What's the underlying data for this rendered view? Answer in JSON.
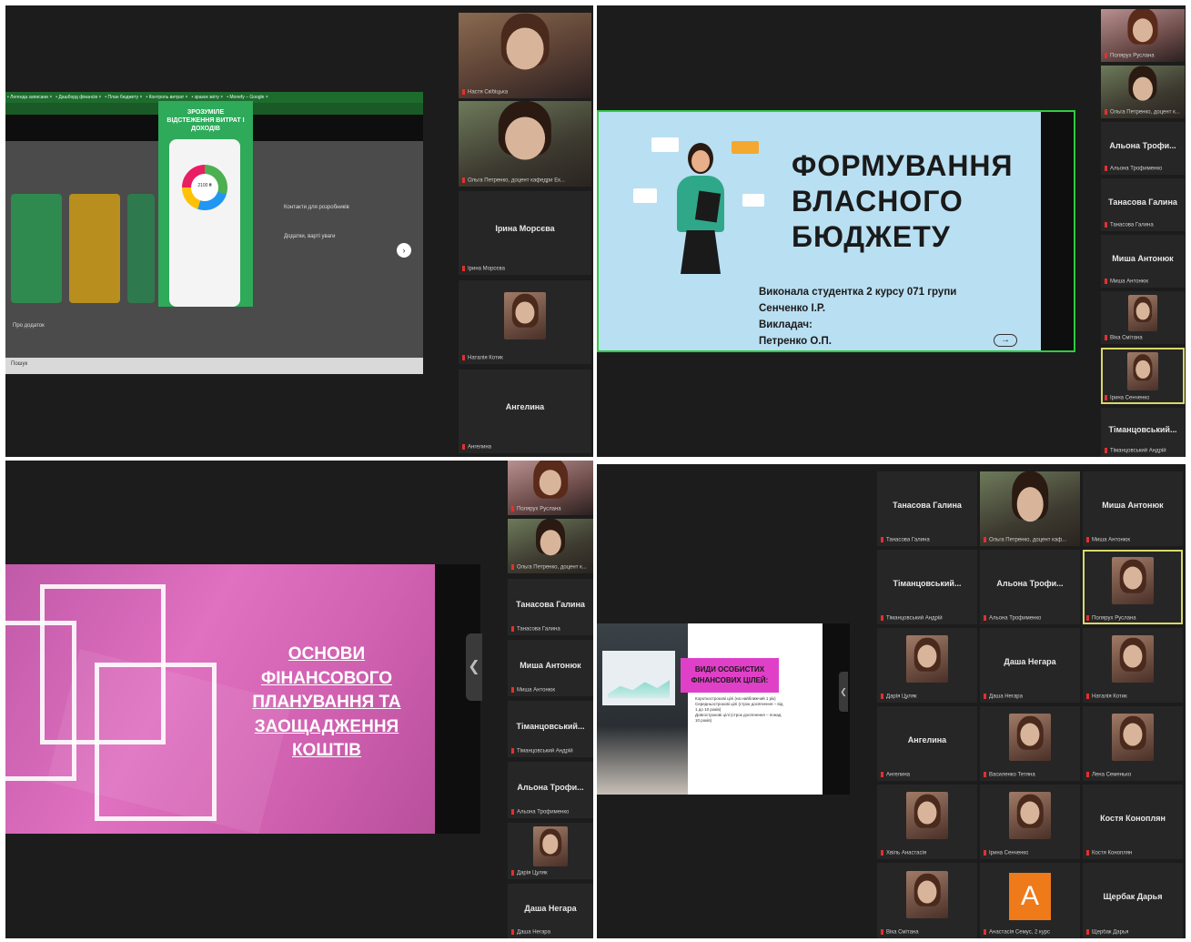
{
  "q1": {
    "browser_tabs": [
      "• Легенда записани ×",
      "• Дашборд фінансів ×",
      "• План бюджету ×",
      "• Контроль витрат ×",
      "• зразок звіту ×",
      "• Monefy – Google ×"
    ],
    "promo_text": "ЗРОЗУМІЛЕ ВІДСТЕЖЕННЯ ВИТРАТ І ДОХОДІВ",
    "phone_amount": "2100 ₴",
    "side_heading": "Контакти для розробників",
    "side_heading2": "Додатки, варті уваги",
    "about_label": "Про додаток",
    "search_label": "Пошук",
    "participants": [
      {
        "name": "Настя Скібіцька",
        "video": true
      },
      {
        "name": "Ольга Петренко, доцент кафедри Ек...",
        "video": true
      },
      {
        "title": "Ірина Морсєва",
        "name": "Ірина Морсєва"
      },
      {
        "name": "Наталія Котик",
        "avatar": true
      },
      {
        "title": "Ангелина",
        "name": "Ангелина"
      }
    ]
  },
  "q2": {
    "title_lines": [
      "ФОРМУВАННЯ",
      "ВЛАСНОГО",
      "БЮДЖЕТУ"
    ],
    "line1": "Виконала студентка 2 курсу 071 групи",
    "line2": "Сенченко І.Р.",
    "line3": "Викладач:",
    "line4": "Петренко О.П.",
    "arrow": "→",
    "participants": [
      {
        "name": "Полярух Руслана",
        "video": true
      },
      {
        "name": "Ольга Петренко, доцент к...",
        "video": true
      },
      {
        "title": "Альона Трофи...",
        "name": "Альона Трофименко"
      },
      {
        "title": "Танасова Галина",
        "name": "Танасова Галина"
      },
      {
        "title": "Миша Антонюк",
        "name": "Миша Антонюк"
      },
      {
        "name": "Віка Смітана",
        "avatar": true
      },
      {
        "name": "Ірина Сенченко",
        "avatar": true,
        "highlight": true
      },
      {
        "title": "Тіманцовський...",
        "name": "Тіманцовський Андрій"
      }
    ]
  },
  "q3": {
    "title_lines": [
      "ОСНОВИ",
      "ФІНАНСОВОГО",
      "ПЛАНУВАННЯ ТА",
      "ЗАОЩАДЖЕННЯ",
      "КОШТІВ"
    ],
    "pull_glyph": "❮",
    "participants": [
      {
        "name": "Полярух Руслана",
        "video": true,
        "highlight": true
      },
      {
        "name": "Ольга Петренко, доцент к...",
        "video": true
      },
      {
        "title": "Танасова Галина",
        "name": "Танасова Галина"
      },
      {
        "title": "Миша Антонюк",
        "name": "Миша Антонюк"
      },
      {
        "title": "Тіманцовський...",
        "name": "Тіманцовський Андрій"
      },
      {
        "title": "Альона Трофи...",
        "name": "Альона Трофименко"
      },
      {
        "name": "Дарія Цуляк",
        "avatar": true
      },
      {
        "title": "Даша Негара",
        "name": "Даша Негара"
      }
    ]
  },
  "q4": {
    "badge_lines": [
      "ВИДИ ОСОБИСТИХ",
      "ФІНАНСОВИХ ЦІЛЕЙ:"
    ],
    "bullets": [
      "Короткострокові цілі (на найближчий 1 рік)",
      "Середньострокові цілі (строк досягнення – від 1 до 10 років)",
      "Довгострокові цілі (строк досягнення – понад 10 років)"
    ],
    "grid": [
      {
        "title": "Танасова Галина",
        "name": "Танасова Галина"
      },
      {
        "name": "Ольга Петренко, доцент каф...",
        "video": true
      },
      {
        "title": "Миша Антонюк",
        "name": "Миша Антонюк"
      },
      {
        "title": "Тіманцовський...",
        "name": "Тіманцовський Андрій"
      },
      {
        "title": "Альона Трофи...",
        "name": "Альона Трофименко"
      },
      {
        "name": "Полярух Руслана",
        "avatar": true,
        "highlight": true
      },
      {
        "name": "Дарія Цуляк",
        "avatar": true
      },
      {
        "title": "Даша Негара",
        "name": "Даша Негара"
      },
      {
        "name": "Наталія Котик",
        "avatar": true
      },
      {
        "title": "Ангелина",
        "name": "Ангелина"
      },
      {
        "name": "Василенко Тетяна",
        "avatar": true
      },
      {
        "name": "Лена Семенько",
        "avatar": true
      },
      {
        "name": "Хвіль Анастасія",
        "avatar": true
      },
      {
        "name": "Ірина Сенченко",
        "avatar": true
      },
      {
        "title": "Костя Коноплян",
        "name": "Костя Коноплян"
      },
      {
        "name": "Віка Смітана",
        "avatar": true
      },
      {
        "name": "Анастасія Семус, 2 курс",
        "letter": "A"
      },
      {
        "title": "Щербак Дарья",
        "name": "Щербак Дарья"
      }
    ]
  }
}
